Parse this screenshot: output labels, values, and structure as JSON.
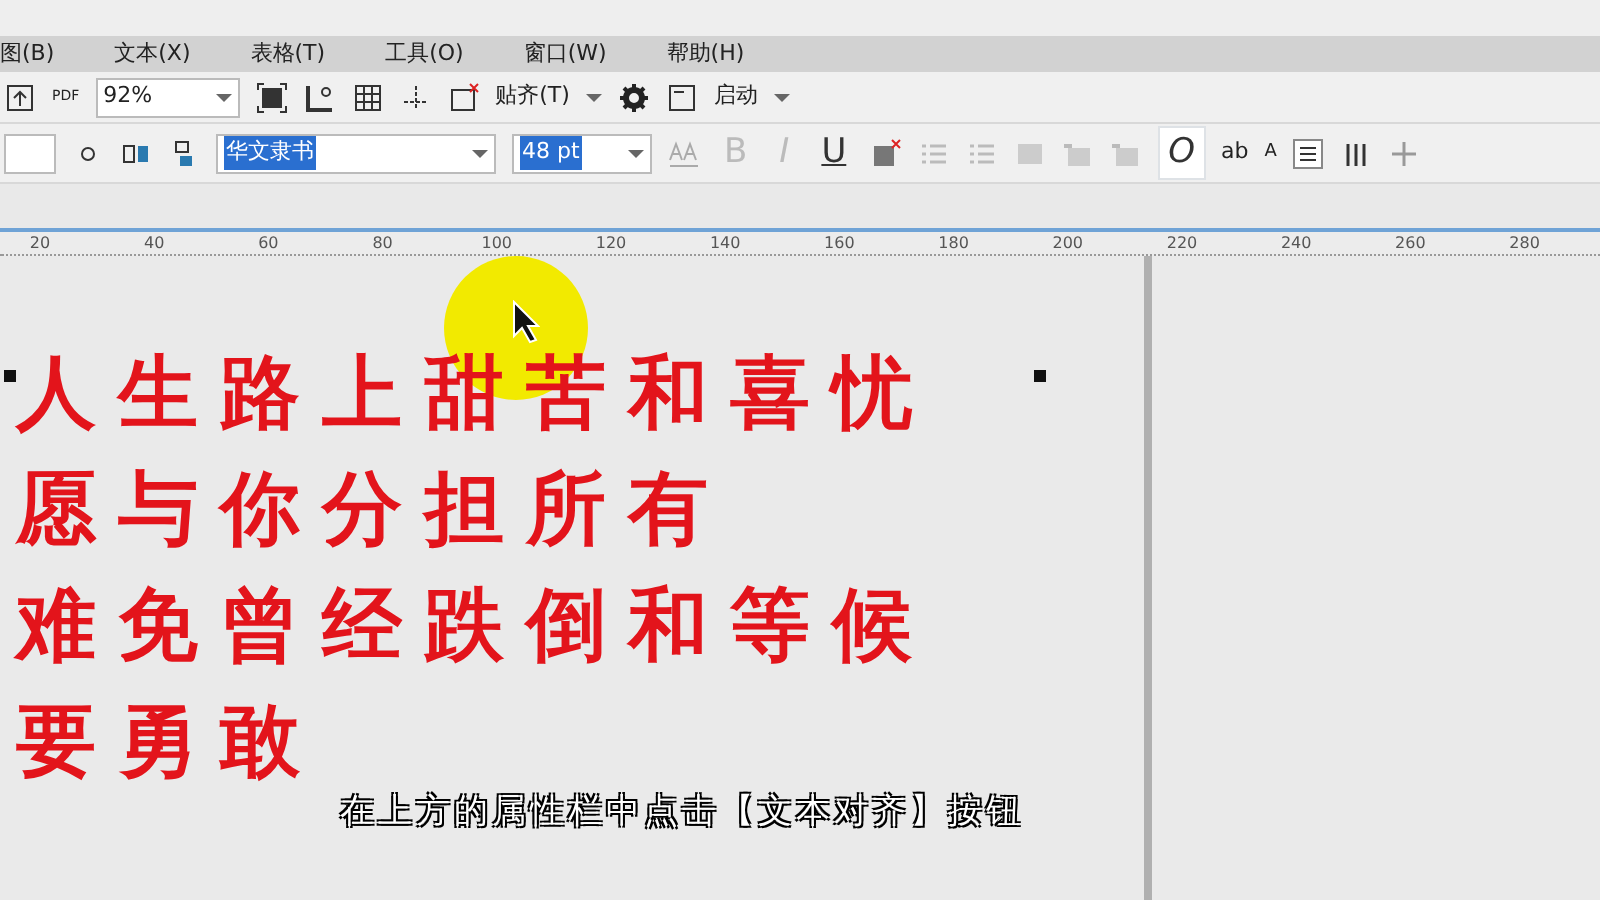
{
  "menu": [
    "图(B)",
    "文本(X)",
    "表格(T)",
    "工具(O)",
    "窗口(W)",
    "帮助(H)"
  ],
  "toolbar": {
    "pdf_label": "PDF",
    "zoom": "92%",
    "snap": "贴齐(T)",
    "launch": "启动"
  },
  "property_bar": {
    "font": {
      "value": "华文隶书",
      "selected": true
    },
    "size": {
      "value": "48 pt",
      "selected": true
    },
    "format_buttons": [
      {
        "label": "B",
        "disabled": true
      },
      {
        "label": "I",
        "disabled": true
      },
      {
        "label": "U",
        "disabled": false
      }
    ],
    "outline_button": "O",
    "ab_label": "ab",
    "a_label": "A"
  },
  "ruler": [
    "20",
    "40",
    "60",
    "80",
    "100",
    "120",
    "140",
    "160",
    "180",
    "200",
    "220",
    "240",
    "260",
    "280"
  ],
  "text_lines": [
    "人生路上甜苦和喜忧",
    "愿与你分担所有",
    "难免曾经跌倒和等候",
    "要勇敢"
  ],
  "caption": "在上方的属性栏中点击【文本对齐】按钮"
}
